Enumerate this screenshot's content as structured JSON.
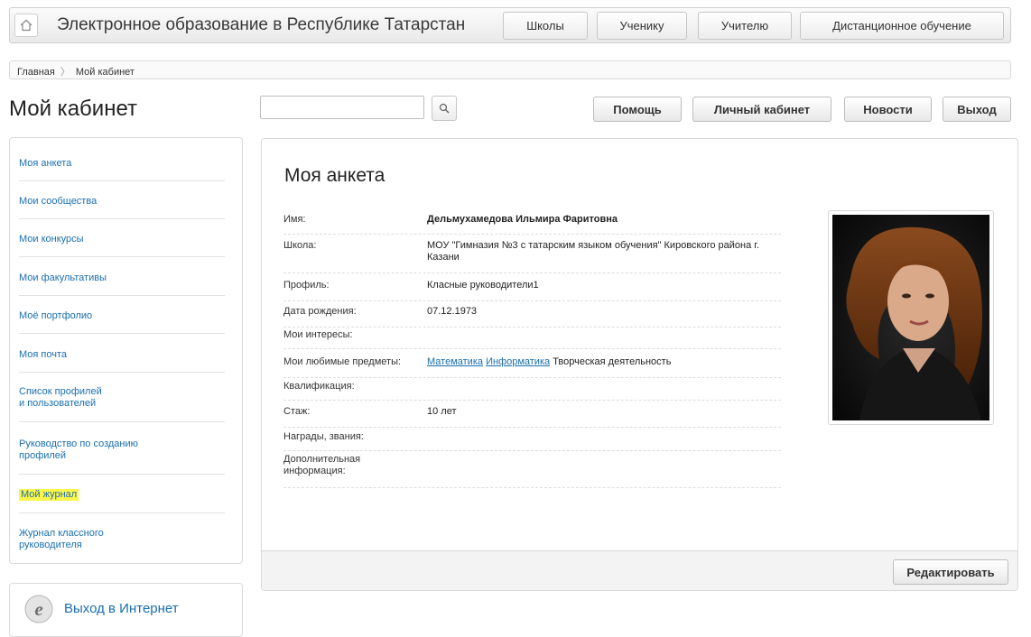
{
  "header": {
    "site_title": "Электронное образование в Республике Татарстан",
    "nav": [
      "Школы",
      "Ученику",
      "Учителю",
      "Дистанционное обучение"
    ]
  },
  "breadcrumb": {
    "home": "Главная",
    "separator": "〉",
    "current": "Мой кабинет"
  },
  "page_title": "Мой кабинет",
  "search": {
    "value": "",
    "placeholder": ""
  },
  "actions": [
    "Помощь",
    "Личный кабинет",
    "Новости",
    "Выход"
  ],
  "sidebar": {
    "items": [
      {
        "label": "Моя анкета"
      },
      {
        "label": "Мои сообщества"
      },
      {
        "label": "Мои конкурсы"
      },
      {
        "label": "Мои факультативы"
      },
      {
        "label": "Моё портфолио"
      },
      {
        "label": "Моя почта"
      },
      {
        "label": "Список профилей\nи пользователей"
      },
      {
        "label": "Руководство по созданию\nпрофилей"
      },
      {
        "label": "Мой журнал",
        "highlighted": true
      },
      {
        "label": "Журнал классного\nруководителя"
      }
    ],
    "internet_label": "Выход в Интернет"
  },
  "profile": {
    "section_title": "Моя анкета",
    "rows": [
      {
        "label": "Имя:",
        "value": "Дельмухамедова Ильмира Фаритовна"
      },
      {
        "label": "Школа:",
        "value": "МОУ \"Гимназия №3 с татарским языком обучения\" Кировского района г. Казани"
      },
      {
        "label": "Профиль:",
        "value": "Класные руководители1"
      },
      {
        "label": "Дата рождения:",
        "value": "07.12.1973"
      },
      {
        "label": "Мои интересы:",
        "value": ""
      },
      {
        "label": "Мои любимые предметы:",
        "links": [
          "Математика",
          "Информатика"
        ],
        "value": "Творческая деятельность"
      },
      {
        "label": "Квалификация:",
        "value": ""
      },
      {
        "label": "Стаж:",
        "value": "10 лет"
      },
      {
        "label": "Награды, звания:",
        "value": ""
      },
      {
        "label": "Дополнительная\nинформация:",
        "value": ""
      }
    ],
    "edit_label": "Редактировать"
  },
  "colors": {
    "link": "#1a6fb0",
    "highlight": "#fdf64a"
  }
}
